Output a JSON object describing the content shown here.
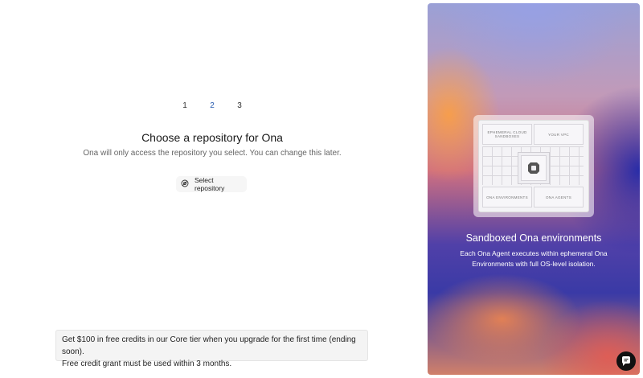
{
  "steps": [
    "1",
    "2",
    "3"
  ],
  "active_step": 2,
  "main": {
    "title": "Choose a repository for Ona",
    "subtitle": "Ona will only access the repository you select. You can change this later.",
    "select_button_label": "Select repository",
    "select_button_icon": "repository-icon"
  },
  "promo": {
    "line1": "Get $100 in free credits in our Core tier when you upgrade for the first time (ending soon).",
    "line2": "Free credit grant must be used within 3 months."
  },
  "panel": {
    "diagram": {
      "top_left": "EPHEMERAL CLOUD SANDBOXES",
      "top_right": "YOUR VPC",
      "bottom_left": "ONA ENVIRONMENTS",
      "bottom_right": "ONA AGENTS"
    },
    "title": "Sandboxed Ona environments",
    "description": "Each Ona Agent executes within ephemeral Ona Environments with full OS-level isolation."
  },
  "chat": {
    "icon": "chat-icon"
  }
}
